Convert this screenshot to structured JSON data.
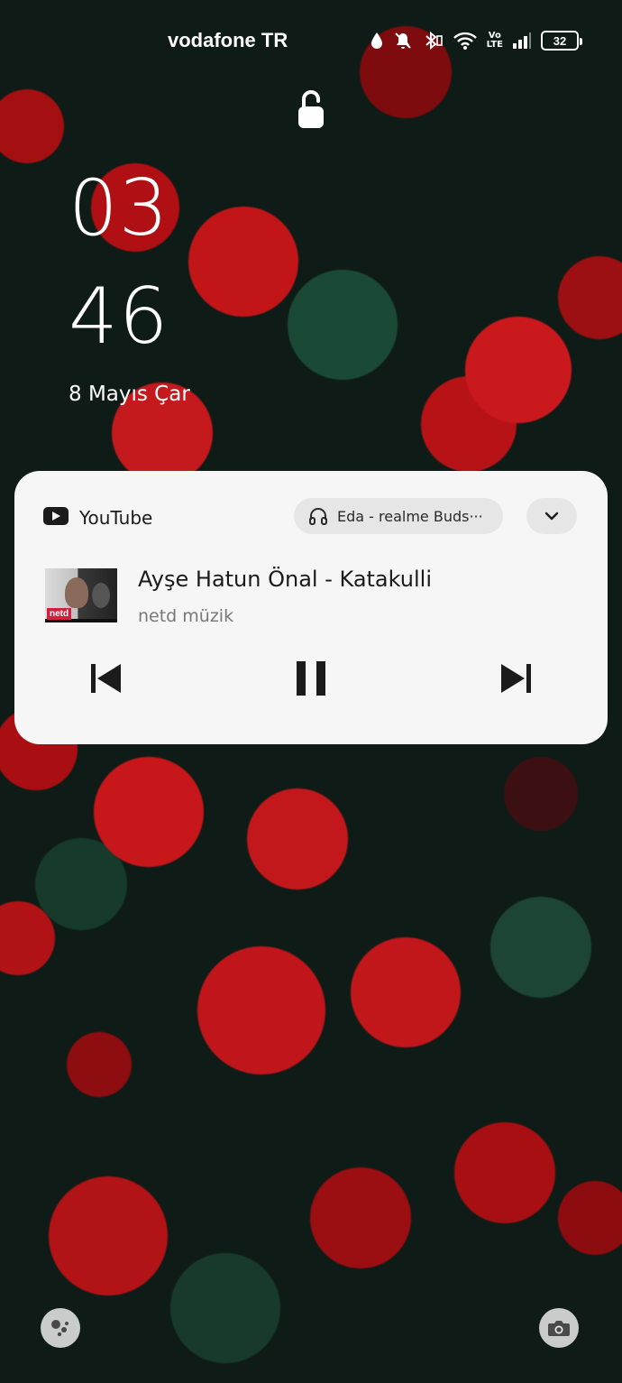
{
  "status_bar": {
    "carrier": "vodafone TR",
    "volte_top": "Vo",
    "volte_bottom": "LTE",
    "battery": "32"
  },
  "lock_screen": {
    "clock_hour": "03",
    "clock_minute": "46",
    "date": "8 Mayıs Çar"
  },
  "media_notification": {
    "app_name": "YouTube",
    "output_device": "Eda - realme Buds···",
    "album_logo": "netd",
    "title": "Ayşe Hatun Önal - Katakulli",
    "artist": "netd müzik"
  }
}
